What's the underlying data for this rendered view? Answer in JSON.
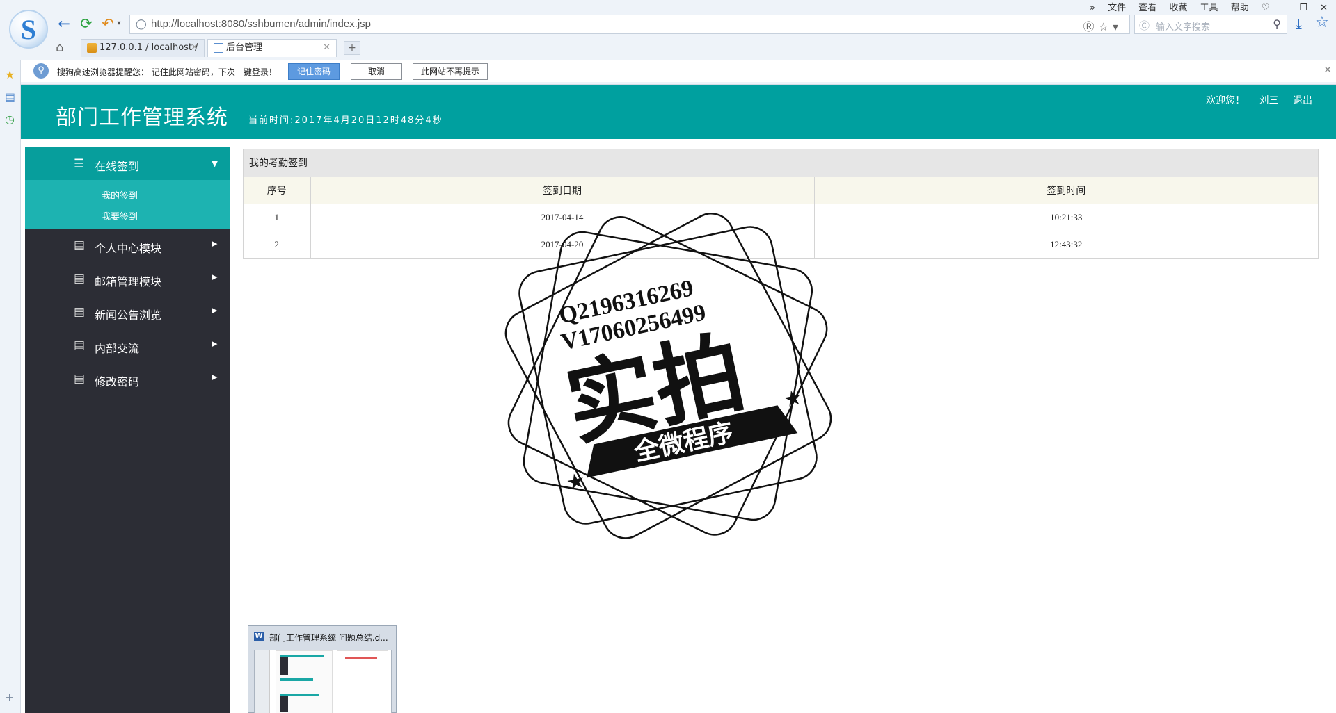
{
  "browser": {
    "menu": [
      "文件",
      "查看",
      "收藏",
      "工具",
      "帮助"
    ],
    "url": "http://localhost:8080/sshbumen/admin/index.jsp",
    "search_placeholder": "输入文字搜索",
    "tabs": [
      {
        "label": "127.0.0.1 / localhost /",
        "active": false
      },
      {
        "label": "后台管理",
        "active": true
      }
    ],
    "new_tab": "+"
  },
  "password_bar": {
    "message": "搜狗高速浏览器提醒您： 记住此网站密码，下次一键登录！",
    "remember_label": "记住密码",
    "cancel_label": "取消",
    "never_label": "此网站不再提示"
  },
  "app": {
    "title": "部门工作管理系统",
    "time": "当前时间:2017年4月20日12时48分4秒",
    "welcome": "欢迎您！",
    "username": "刘三",
    "logout": "退出"
  },
  "sidebar": {
    "open_menu": {
      "label": "在线签到",
      "subitems": [
        "我的签到",
        "我要签到"
      ]
    },
    "items": [
      "个人中心模块",
      "邮箱管理模块",
      "新闻公告浏览",
      "内部交流",
      "修改密码"
    ]
  },
  "panel": {
    "title": "我的考勤签到",
    "columns": [
      "序号",
      "签到日期",
      "签到时间"
    ],
    "rows": [
      [
        "1",
        "2017-04-14",
        "10:21:33"
      ],
      [
        "2",
        "2017-04-20",
        "12:43:32"
      ]
    ]
  },
  "watermark": {
    "line1": "Q2196316269",
    "line2": "V17060256499",
    "main": "实拍",
    "banner": "全微程序"
  },
  "taskbar_preview": {
    "title": "部门工作管理系统  问题总结.d..."
  },
  "colors": {
    "header_teal": "#00a09f",
    "submenu_teal": "#1db3b1",
    "sidebar_dark": "#2c2d35",
    "table_header_bg": "#f8f7ec"
  }
}
